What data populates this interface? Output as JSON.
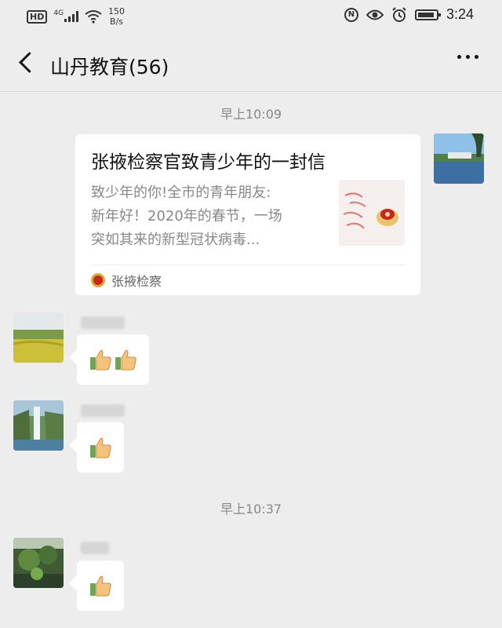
{
  "status_bar": {
    "hd": "HD",
    "network": "4G",
    "speed_value": "150",
    "speed_unit": "B/s",
    "time": "3:24",
    "icons": [
      "hd-icon",
      "signal-icon",
      "wifi-icon",
      "nfc-icon",
      "eye-icon",
      "alarm-icon",
      "battery-icon"
    ]
  },
  "header": {
    "title": "山丹教育(56)"
  },
  "messages": {
    "timestamp_1": "早上10:09",
    "card": {
      "title": "张掖检察官致青少年的一封信",
      "desc_lines": [
        "致少年的你!全市的青年朋友:",
        "新年好！2020年的春节，一场",
        "突如其来的新型冠状病毒..."
      ],
      "source": "张掖检察"
    },
    "timestamp_2": "早上10:37",
    "reactions": [
      {
        "emoji": "thumbs-up",
        "count": 2
      },
      {
        "emoji": "thumbs-up",
        "count": 1
      },
      {
        "emoji": "thumbs-up",
        "count": 1
      }
    ]
  },
  "colors": {
    "background": "#ededed",
    "bubble": "#ffffff",
    "timestamp": "#888888",
    "emblem_red": "#c8261c"
  }
}
